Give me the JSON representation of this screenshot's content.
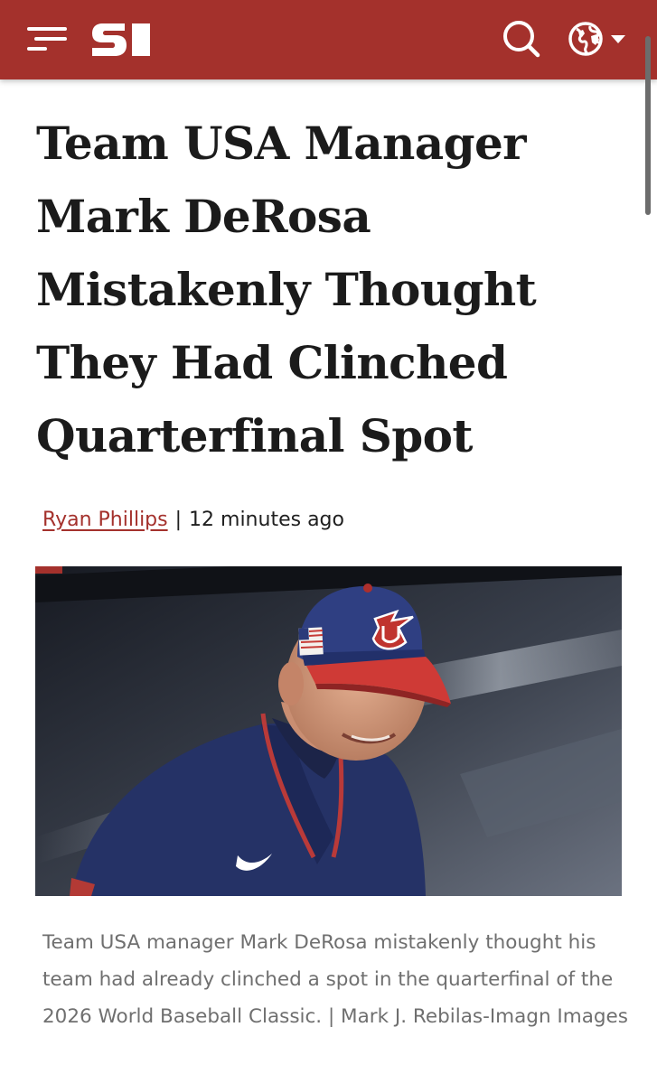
{
  "header": {
    "logo_text": "SI",
    "menu_icon": "hamburger-menu-icon",
    "search_icon": "search-icon",
    "region_icon": "globe-icon",
    "brand_color": "#a4312c"
  },
  "article": {
    "title": "Team USA Manager Mark DeRosa Mistakenly Thought They Had Clinched Quarterfinal Spot",
    "author": "Ryan Phillips",
    "separator": "|",
    "timestamp": "12 minutes ago",
    "image_caption": "Team USA manager Mark DeRosa mistakenly thought his team had already clinched a spot in the quarterfinal of the 2026 World Baseball Classic. | Mark J. Rebilas-Imagn Images"
  }
}
